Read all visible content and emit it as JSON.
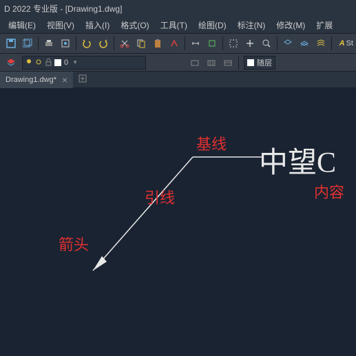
{
  "title": "D 2022 专业版 - [Drawing1.dwg]",
  "menus": [
    "编辑(E)",
    "视图(V)",
    "插入(I)",
    "格式(O)",
    "工具(T)",
    "绘图(D)",
    "标注(N)",
    "修改(M)",
    "扩展"
  ],
  "layer": {
    "name": "0"
  },
  "bylayer": "随层",
  "tab": {
    "filename": "Drawing1.dwg*",
    "close": "×"
  },
  "annotations": {
    "baseline": "基线",
    "leader": "引线",
    "arrow": "箭头",
    "content": "内容"
  },
  "leader_text": "中望C",
  "text_style": {
    "A": "A",
    "label": "St"
  },
  "icons": {
    "save": "save",
    "saveall": "saveall",
    "print": "print",
    "preview": "preview",
    "undo": "undo",
    "redo": "redo",
    "cut": "cut",
    "copy": "copy",
    "paste": "paste",
    "match": "match",
    "dist": "dist",
    "area": "area",
    "pan": "pan",
    "zoom": "zoom",
    "layer_mgr": "layer",
    "layer_btn1": "lb1",
    "layer_btn2": "lb2"
  }
}
